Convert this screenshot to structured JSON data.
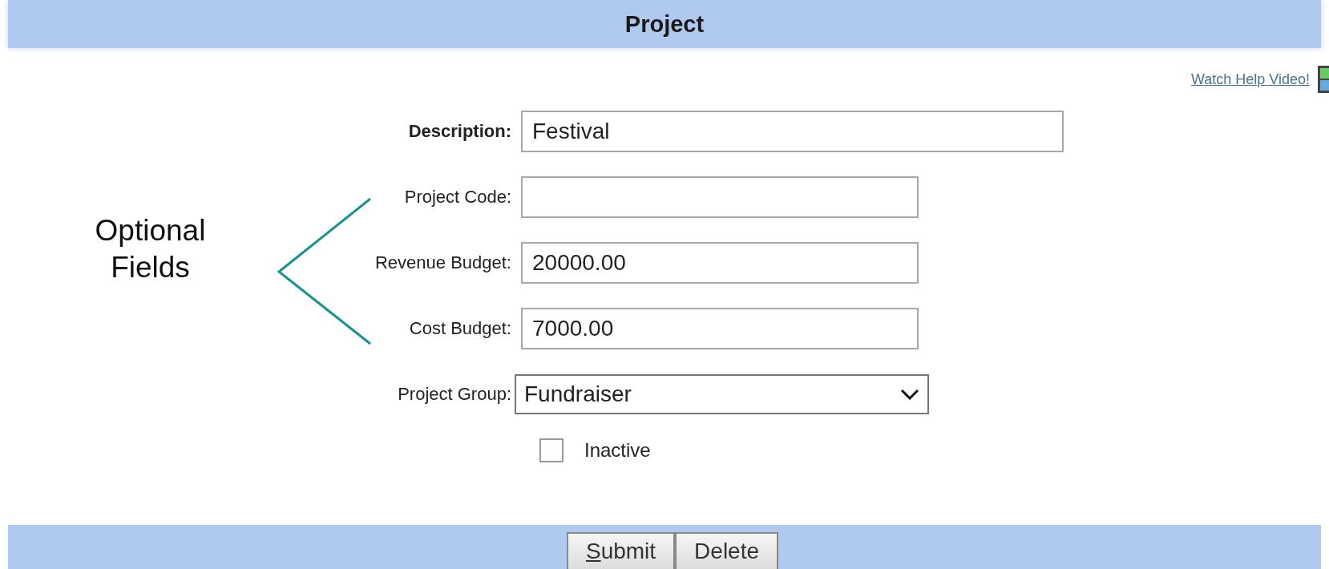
{
  "header": {
    "title": "Project"
  },
  "help_link": {
    "label": "Watch Help Video!"
  },
  "fields": [
    {
      "kind": "text",
      "label": "Description:",
      "value": "Festival",
      "bold": true,
      "wide": true
    },
    {
      "kind": "text",
      "label": "Project Code:",
      "bold": false,
      "wide": false
    },
    {
      "kind": "text",
      "label": "Revenue Budget:",
      "value": "20000.00",
      "bold": false,
      "wide": false
    },
    {
      "kind": "text",
      "label": "Cost Budget:",
      "value": "7000.00",
      "bold": false,
      "wide": false
    },
    {
      "kind": "select",
      "label": "Project Group:",
      "value": "Fundraiser",
      "bold": false
    },
    {
      "kind": "checkbox",
      "label": "Inactive",
      "checked": false
    }
  ],
  "annotation": {
    "text": "Optional Fields"
  },
  "buttons": [
    {
      "label": "Submit",
      "mnemonic": true
    },
    {
      "label": "Delete",
      "mnemonic": false
    }
  ]
}
